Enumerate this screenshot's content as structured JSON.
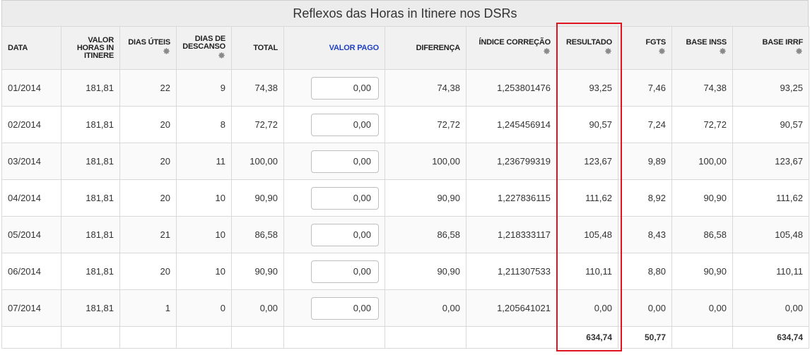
{
  "title": "Reflexos das Horas in Itinere nos DSRs",
  "columns": [
    {
      "key": "data",
      "label": "DATA",
      "gear": false,
      "align": "left"
    },
    {
      "key": "valor",
      "label": "VALOR HORAS IN ITINERE",
      "gear": false
    },
    {
      "key": "dias_uteis",
      "label": "DIAS ÚTEIS",
      "gear": true
    },
    {
      "key": "dias_descanso",
      "label": "DIAS DE DESCANSO",
      "gear": true
    },
    {
      "key": "total",
      "label": "TOTAL",
      "gear": false
    },
    {
      "key": "valor_pago",
      "label": "VALOR PAGO",
      "gear": false,
      "link": true
    },
    {
      "key": "diferenca",
      "label": "DIFERENÇA",
      "gear": false
    },
    {
      "key": "indice",
      "label": "ÍNDICE CORREÇÃO",
      "gear": true
    },
    {
      "key": "resultado",
      "label": "RESULTADO",
      "gear": true
    },
    {
      "key": "fgts",
      "label": "FGTS",
      "gear": true
    },
    {
      "key": "base_inss",
      "label": "BASE INSS",
      "gear": true
    },
    {
      "key": "base_irrf",
      "label": "BASE IRRF",
      "gear": true
    }
  ],
  "rows": [
    {
      "data": "01/2014",
      "valor": "181,81",
      "dias_uteis": "22",
      "dias_descanso": "9",
      "total": "74,38",
      "valor_pago": "0,00",
      "diferenca": "74,38",
      "indice": "1,253801476",
      "resultado": "93,25",
      "fgts": "7,46",
      "base_inss": "74,38",
      "base_irrf": "93,25"
    },
    {
      "data": "02/2014",
      "valor": "181,81",
      "dias_uteis": "20",
      "dias_descanso": "8",
      "total": "72,72",
      "valor_pago": "0,00",
      "diferenca": "72,72",
      "indice": "1,245456914",
      "resultado": "90,57",
      "fgts": "7,24",
      "base_inss": "72,72",
      "base_irrf": "90,57"
    },
    {
      "data": "03/2014",
      "valor": "181,81",
      "dias_uteis": "20",
      "dias_descanso": "11",
      "total": "100,00",
      "valor_pago": "0,00",
      "diferenca": "100,00",
      "indice": "1,236799319",
      "resultado": "123,67",
      "fgts": "9,89",
      "base_inss": "100,00",
      "base_irrf": "123,67"
    },
    {
      "data": "04/2014",
      "valor": "181,81",
      "dias_uteis": "20",
      "dias_descanso": "10",
      "total": "90,90",
      "valor_pago": "0,00",
      "diferenca": "90,90",
      "indice": "1,227836115",
      "resultado": "111,62",
      "fgts": "8,92",
      "base_inss": "90,90",
      "base_irrf": "111,62"
    },
    {
      "data": "05/2014",
      "valor": "181,81",
      "dias_uteis": "21",
      "dias_descanso": "10",
      "total": "86,58",
      "valor_pago": "0,00",
      "diferenca": "86,58",
      "indice": "1,218333117",
      "resultado": "105,48",
      "fgts": "8,43",
      "base_inss": "86,58",
      "base_irrf": "105,48"
    },
    {
      "data": "06/2014",
      "valor": "181,81",
      "dias_uteis": "20",
      "dias_descanso": "10",
      "total": "90,90",
      "valor_pago": "0,00",
      "diferenca": "90,90",
      "indice": "1,211307533",
      "resultado": "110,11",
      "fgts": "8,80",
      "base_inss": "90,90",
      "base_irrf": "110,11"
    },
    {
      "data": "07/2014",
      "valor": "181,81",
      "dias_uteis": "1",
      "dias_descanso": "0",
      "total": "0,00",
      "valor_pago": "0,00",
      "diferenca": "0,00",
      "indice": "1,205641021",
      "resultado": "0,00",
      "fgts": "0,00",
      "base_inss": "0,00",
      "base_irrf": "0,00"
    }
  ],
  "totals": {
    "resultado": "634,74",
    "fgts": "50,77",
    "base_irrf": "634,74"
  },
  "colors": {
    "highlight": "#e0141e",
    "link": "#1f3fbf",
    "header_bg": "#f1f1f1"
  }
}
